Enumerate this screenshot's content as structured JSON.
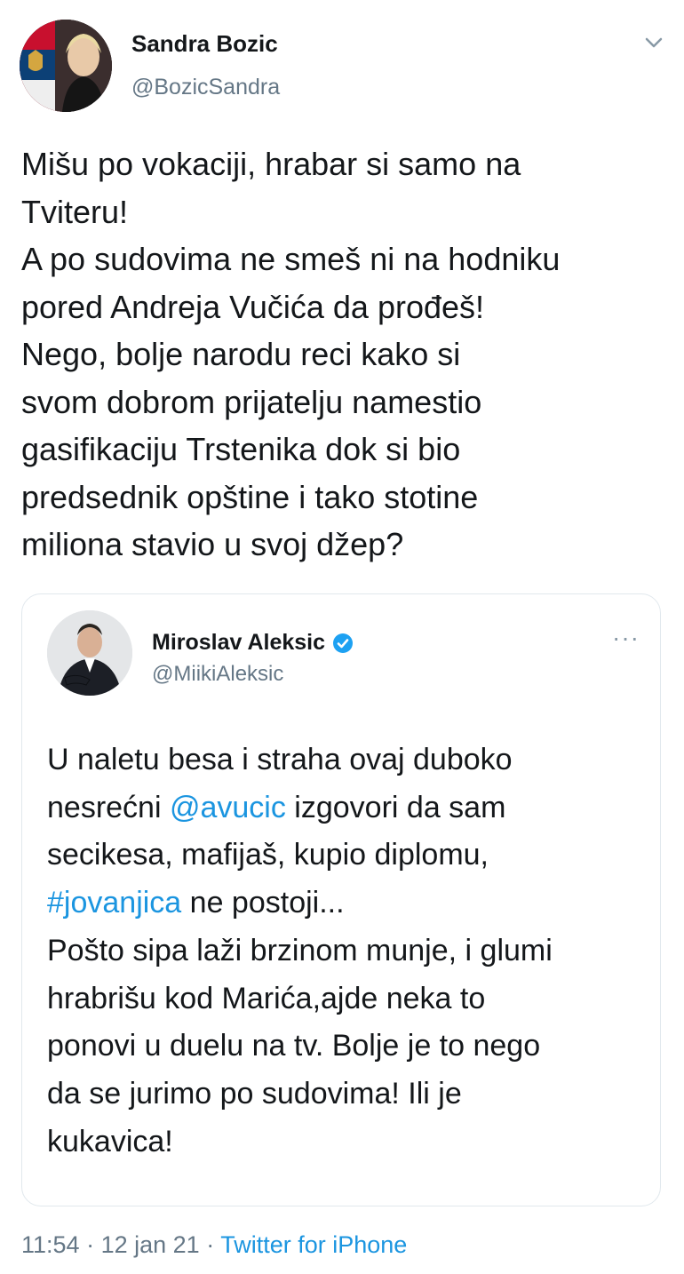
{
  "tweet": {
    "author_name": "Sandra Bozic",
    "author_handle": "@BozicSandra",
    "text_lines": [
      "Mišu po vokaciji, hrabar si samo na",
      "Tviteru!",
      "A po sudovima ne smeš ni na hodniku",
      "pored Andreja Vučića da prođeš!",
      "Nego, bolje narodu reci kako si",
      "svom dobrom prijatelju namestio",
      "gasifikaciju Trstenika dok si bio",
      "predsednik opštine i tako stotine",
      "miliona stavio u svoj džep?"
    ],
    "time": "11:54",
    "separator": "·",
    "date": "12 jan 21",
    "source": "Twitter for iPhone"
  },
  "quoted": {
    "author_name": "Miroslav Aleksic",
    "author_handle": "@MiikiAleksic",
    "more_label": "···",
    "line1": "U naletu besa i straha ovaj duboko",
    "line2_mention": "@avucic",
    "line2_prefix": "nesrećni ",
    "line2_suffix": " izgovori da sam",
    "line3": "secikesa, mafijaš, kupio diplomu,",
    "line4_hashtag": "#jovanjica",
    "line4_suffix": " ne postoji...",
    "line5": "Pošto sipa laži brzinom munje, i glumi",
    "line6": "hrabrišu kod Marića,ajde neka to",
    "line7": "ponovi u duelu na tv. Bolje je to nego",
    "line8": "da se jurimo po sudovima! Ili je",
    "line9": "kukavica!"
  },
  "colors": {
    "link": "#1b95e0",
    "verified": "#1da1f2",
    "secondary_text": "#657786"
  }
}
